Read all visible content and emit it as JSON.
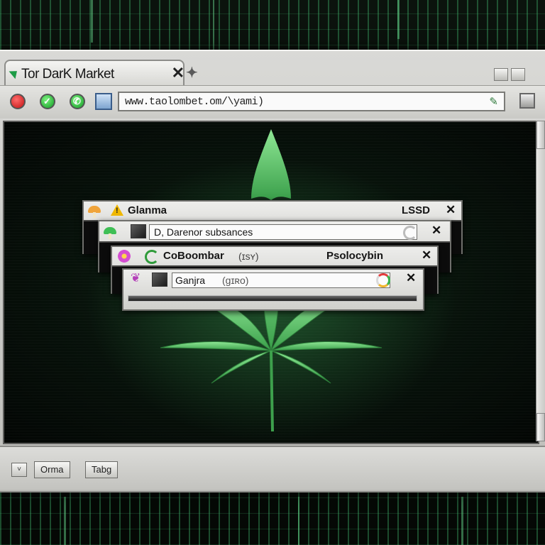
{
  "browser": {
    "tab_title": "Tor DarK Market",
    "tab_close": "✕",
    "new_tab": "✦",
    "url": "www.taolombet.om/\\yami)",
    "url_icon": "✎",
    "menu_icon": "▤"
  },
  "dialogs": [
    {
      "label": "Glanma",
      "right_label": "LSSD",
      "close": "✕"
    },
    {
      "label": "D, Darenor subsances",
      "close": "✕"
    },
    {
      "label": "CoBoombar",
      "sub_label": "(ɪsʏ)",
      "right_label": "Psolocybin",
      "close": "✕"
    },
    {
      "label": "Ganjra",
      "sub_label": "(ɡɪʀo)",
      "close": "✕"
    }
  ],
  "statusbar": {
    "dropdown": "˅",
    "button1": "Orma",
    "button2": "Tabg"
  },
  "colors": {
    "accent_green": "#2f9b3a",
    "leaf_green": "#5ec96a",
    "background": "#050805"
  }
}
